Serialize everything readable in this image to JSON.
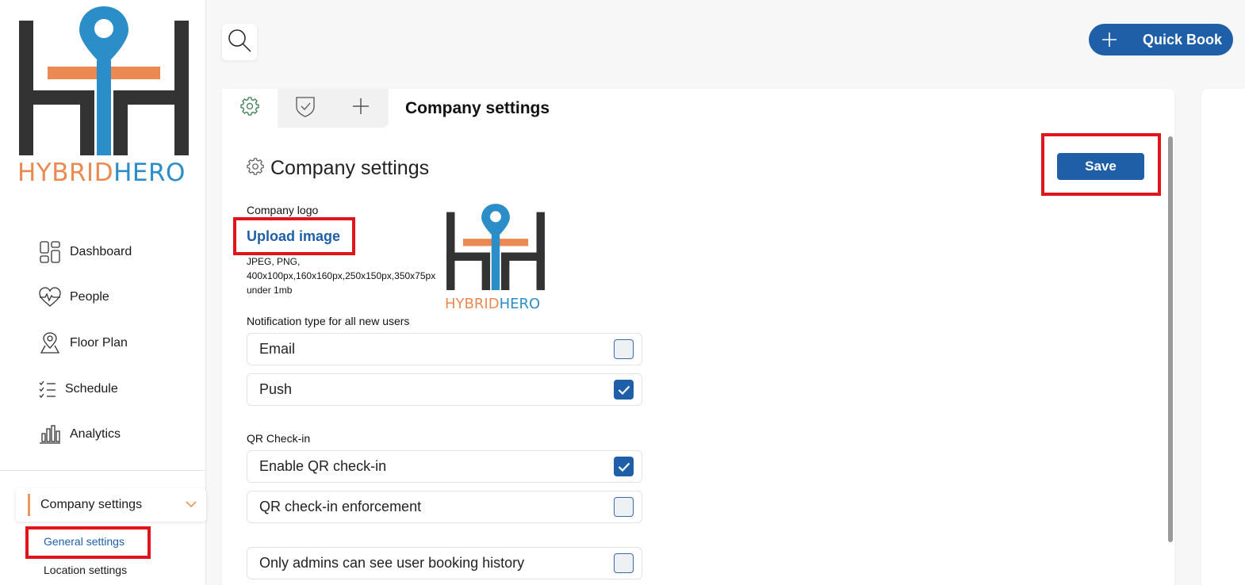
{
  "brand": {
    "name_part1": "HYBRID",
    "name_part2": "HERO",
    "color_dark": "#333333",
    "color_orange": "#ea8a52",
    "color_blue": "#2c8ec9"
  },
  "sidebar": {
    "items": [
      {
        "label": "Dashboard",
        "icon": "dashboard-icon"
      },
      {
        "label": "People",
        "icon": "heart-pulse-icon"
      },
      {
        "label": "Floor Plan",
        "icon": "map-pin-icon"
      },
      {
        "label": "Schedule",
        "icon": "checklist-icon"
      },
      {
        "label": "Analytics",
        "icon": "bar-chart-icon"
      }
    ],
    "group": {
      "label": "Company settings",
      "expanded": true
    },
    "subitems": [
      {
        "label": "General settings",
        "active": true
      },
      {
        "label": "Location settings",
        "active": false
      }
    ]
  },
  "topbar": {
    "search_icon": "search-icon",
    "quickbook_label": "Quick Book"
  },
  "card": {
    "title": "Company settings",
    "tabs": [
      {
        "icon": "gear-icon",
        "active": true
      },
      {
        "icon": "shield-check-icon",
        "active": false
      },
      {
        "icon": "plus-icon",
        "active": false
      }
    ],
    "section_title": "Company settings",
    "save_label": "Save",
    "logo": {
      "label": "Company logo",
      "upload_label": "Upload image",
      "hint_lines": [
        "JPEG, PNG,",
        "400x100px,160x160px,250x150px,350x75px",
        "under 1mb"
      ]
    },
    "notification": {
      "label": "Notification type for all new users",
      "options": [
        {
          "label": "Email",
          "checked": false
        },
        {
          "label": "Push",
          "checked": true
        }
      ]
    },
    "qr": {
      "label": "QR Check-in",
      "options": [
        {
          "label": "Enable QR check-in",
          "checked": true
        },
        {
          "label": "QR check-in enforcement",
          "checked": false
        }
      ]
    },
    "history_option": {
      "label": "Only admins can see user booking history",
      "checked": false
    }
  },
  "accent": "#1e5fa8",
  "highlight": "#e0141c"
}
